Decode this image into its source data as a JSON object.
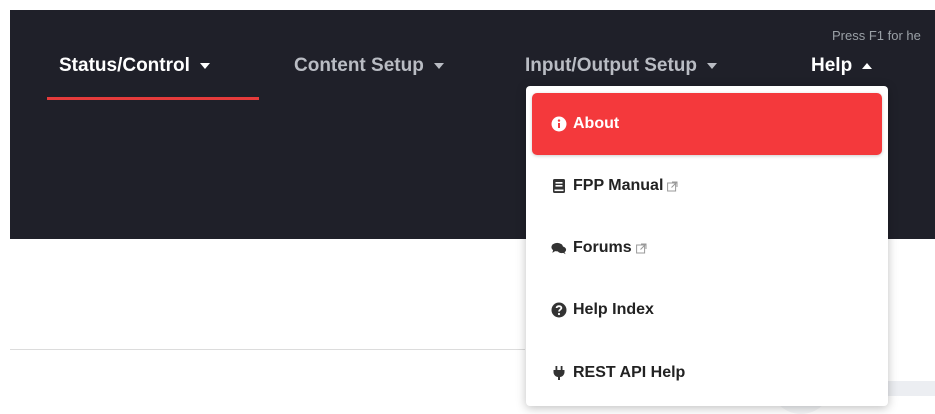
{
  "header": {
    "help_hint": "Press F1 for he"
  },
  "nav": {
    "items": [
      {
        "label": "Status/Control",
        "active": true
      },
      {
        "label": "Content Setup"
      },
      {
        "label": "Input/Output Setup"
      },
      {
        "label": "Help",
        "expanded": true
      }
    ]
  },
  "help_menu": {
    "items": [
      {
        "label": "About",
        "icon": "info-circle-icon",
        "active": true
      },
      {
        "label": "FPP Manual",
        "icon": "book-icon",
        "external": true
      },
      {
        "label": "Forums",
        "icon": "comments-icon",
        "external": true
      },
      {
        "label": "Help Index",
        "icon": "question-circle-icon"
      },
      {
        "label": "REST API Help",
        "icon": "plug-icon"
      }
    ]
  },
  "colors": {
    "topbar_bg": "#1f2029",
    "accent": "#f4393c",
    "active_underline": "#e53b3b"
  }
}
